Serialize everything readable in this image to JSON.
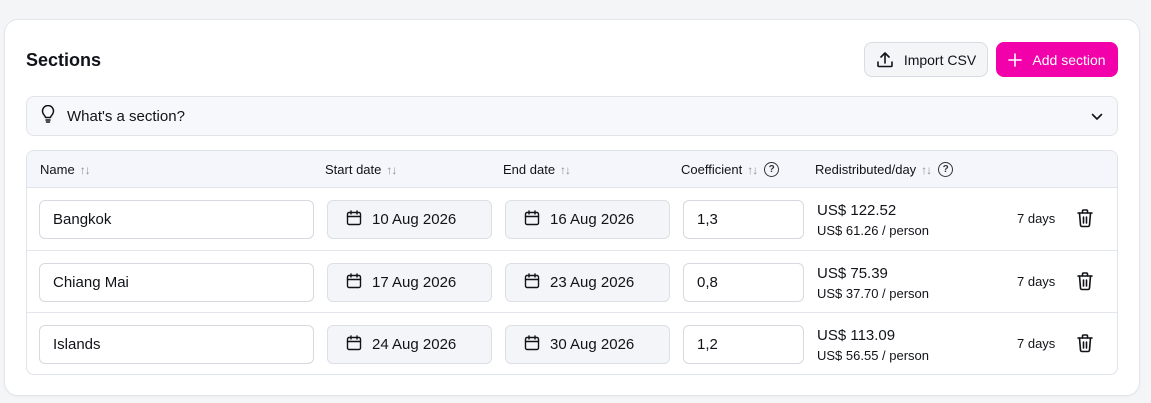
{
  "header": {
    "title": "Sections",
    "import_label": "Import CSV",
    "add_label": "Add section"
  },
  "help": {
    "label": "What's a section?"
  },
  "table": {
    "columns": {
      "name": "Name",
      "start": "Start date",
      "end": "End date",
      "coef": "Coefficient",
      "redistributed": "Redistributed/day"
    },
    "info_glyph": "?",
    "rows": [
      {
        "name": "Bangkok",
        "start": "10 Aug 2026",
        "end": "16 Aug 2026",
        "coef": "1,3",
        "amount": "US$ 122.52",
        "per_person": "US$ 61.26 / person",
        "days": "7 days"
      },
      {
        "name": "Chiang Mai",
        "start": "17 Aug 2026",
        "end": "23 Aug 2026",
        "coef": "0,8",
        "amount": "US$ 75.39",
        "per_person": "US$ 37.70 / person",
        "days": "7 days"
      },
      {
        "name": "Islands",
        "start": "24 Aug 2026",
        "end": "30 Aug 2026",
        "coef": "1,2",
        "amount": "US$ 113.09",
        "per_person": "US$ 56.55 / person",
        "days": "7 days"
      }
    ]
  },
  "icons": {
    "upload": "upload-icon",
    "plus": "plus-icon",
    "bulb": "lightbulb-icon",
    "chevron": "chevron-down-icon",
    "sort": "sort-icon",
    "info": "info-icon",
    "calendar": "calendar-icon",
    "trash": "trash-icon"
  },
  "colors": {
    "accent": "#f200a9",
    "header_bg": "#f4f6fc",
    "text": "#111318"
  }
}
